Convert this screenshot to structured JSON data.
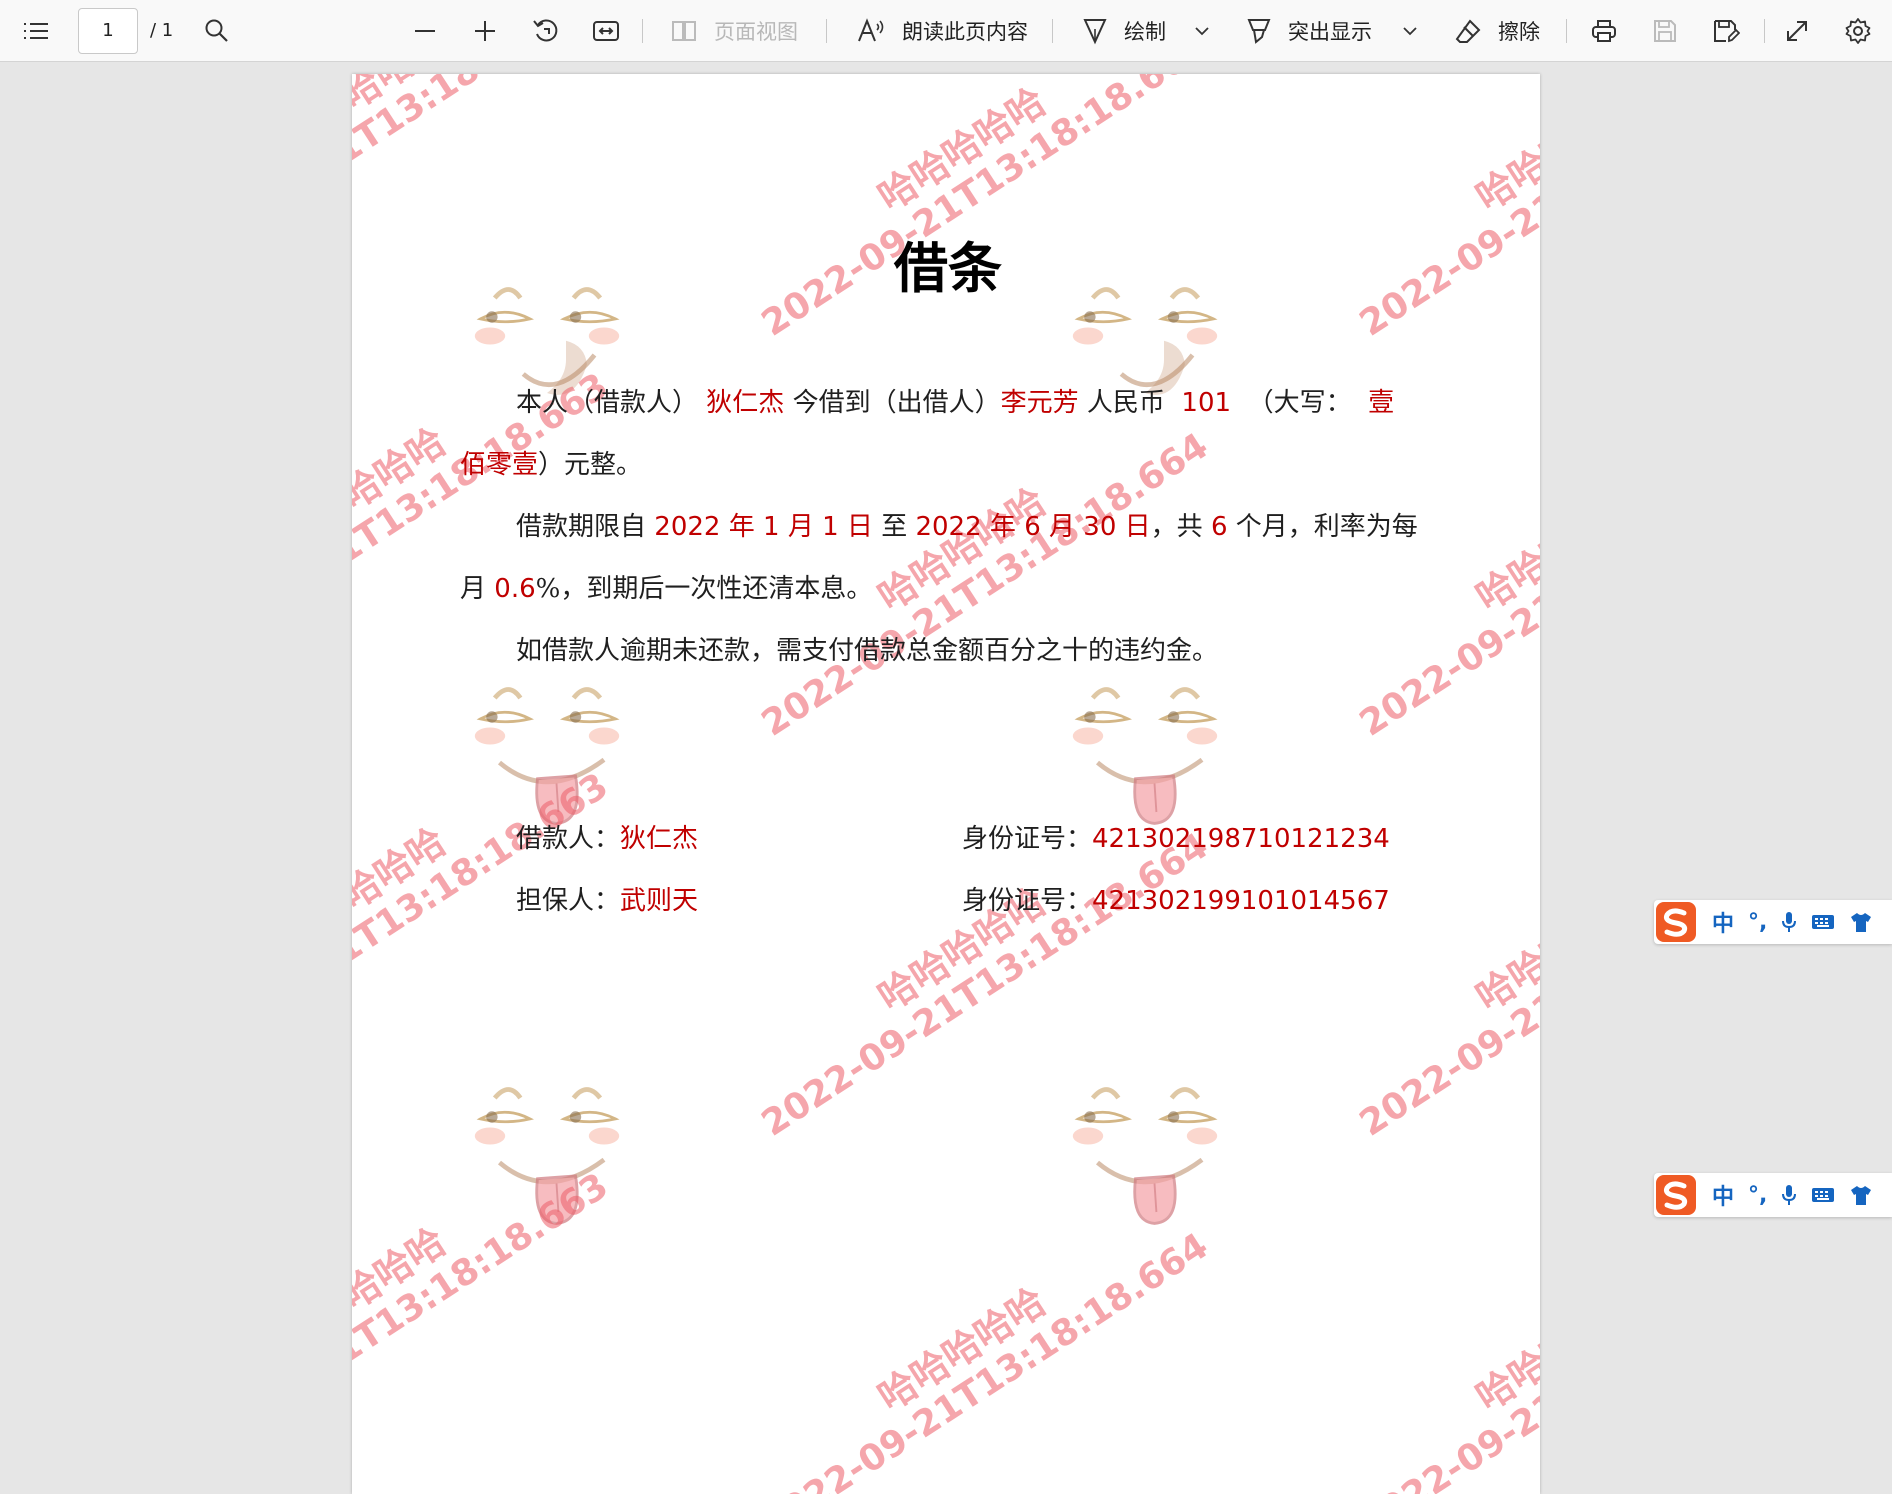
{
  "toolbar": {
    "page_current": "1",
    "page_total": "/ 1",
    "page_view_label": "页面视图",
    "read_aloud_label": "朗读此页内容",
    "draw_label": "绘制",
    "highlight_label": "突出显示",
    "erase_label": "擦除"
  },
  "document": {
    "title": "借条",
    "p1_prefix": "本人（借款人）",
    "borrower": "狄仁杰",
    "p1_mid": "今借到（出借人）",
    "lender": "李元芳",
    "p1_rmb": "人民币",
    "amount": "101",
    "p1_daxie": "（大写：",
    "amount_cn_1": "壹",
    "amount_cn_2": "佰零壹",
    "p1_end": "）元整。",
    "p2_prefix": "借款期限自",
    "start_year": "2022",
    "start_month": "1",
    "start_day": "1",
    "nian": "年",
    "yue": "月",
    "ri": "日",
    "zhi": "至",
    "end_year": "2022",
    "end_month": "6",
    "end_day": "30",
    "gong": "，共",
    "months": "6",
    "p2_rate": "个月，利率为每",
    "p2_month": "月",
    "rate": "0.6",
    "p2_end": "%，到期后一次性还清本息。",
    "p3": "如借款人逾期未还款，需支付借款总金额百分之十的违约金。",
    "borrower_label": "借款人：",
    "borrower_sig": "狄仁杰",
    "id_label_1": "身份证号：",
    "id_1": "421302198710121234",
    "guarantor_label": "担保人：",
    "guarantor": "武则天",
    "id_label_2": "身份证号：",
    "id_2": "421302199101014567"
  },
  "watermark": {
    "line1": "哈哈哈哈哈",
    "line2": "2022-09-21T13:18:18.664",
    "line2_alt": "2022-09-21T13:18:18.663",
    "color": "#ec5c68"
  },
  "ime": {
    "lang": "中",
    "punct": "°,"
  }
}
